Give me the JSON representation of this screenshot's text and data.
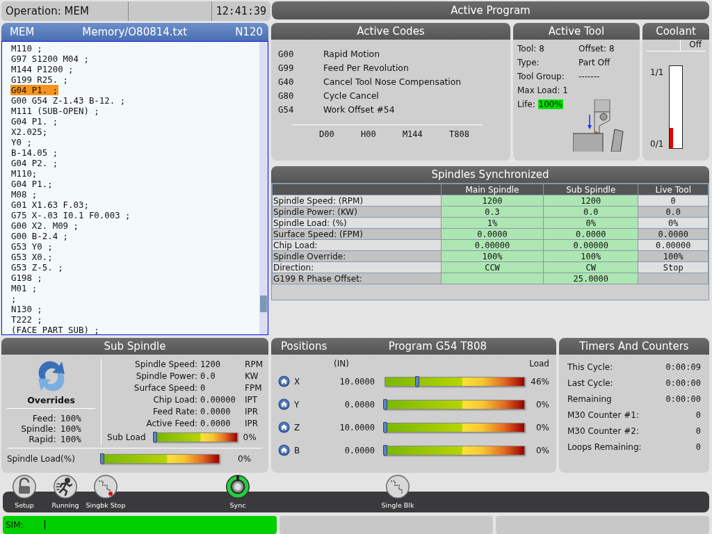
{
  "status": {
    "operation": "Operation: MEM",
    "time": "12:41:39"
  },
  "active_program_title": "Active Program",
  "program": {
    "mode": "MEM",
    "path": "Memory/O80814.txt",
    "block": "N120",
    "lines": [
      {
        "text": "M110 ;",
        "selected": false
      },
      {
        "text": "G97 S1200 M04 ;",
        "selected": false
      },
      {
        "text": "M144 P1200 ;",
        "selected": false
      },
      {
        "text": "G199 R25. ;",
        "selected": false
      },
      {
        "text": "G04 P1. ;",
        "selected": true
      },
      {
        "text": "G00 G54 Z-1.43 B-12. ;",
        "selected": false
      },
      {
        "text": "M111 (SUB-OPEN) ;",
        "selected": false
      },
      {
        "text": "G04 P1. ;",
        "selected": false
      },
      {
        "text": "X2.025;",
        "selected": false
      },
      {
        "text": "Y0 ;",
        "selected": false
      },
      {
        "text": "B-14.05 ;",
        "selected": false
      },
      {
        "text": "G04 P2. ;",
        "selected": false
      },
      {
        "text": "M110;",
        "selected": false
      },
      {
        "text": "G04 P1.;",
        "selected": false
      },
      {
        "text": "M08 ;",
        "selected": false
      },
      {
        "text": "G01 X1.63 F.03;",
        "selected": false
      },
      {
        "text": "G75 X-.03 I0.1 F0.003 ;",
        "selected": false
      },
      {
        "text": "G00 X2. M09 ;",
        "selected": false
      },
      {
        "text": "G00 B-2.4 ;",
        "selected": false
      },
      {
        "text": "G53 Y0 ;",
        "selected": false
      },
      {
        "text": "G53 X0.;",
        "selected": false
      },
      {
        "text": "G53 Z-5. ;",
        "selected": false
      },
      {
        "text": "G198 ;",
        "selected": false
      },
      {
        "text": "M01 ;",
        "selected": false
      },
      {
        "text": ";",
        "selected": false
      },
      {
        "text": "N130 ;",
        "selected": false
      },
      {
        "text": "T222 ;",
        "selected": false
      },
      {
        "text": "(FACE PART SUB) ;",
        "selected": false
      }
    ]
  },
  "active_codes": {
    "title": "Active Codes",
    "codes": [
      {
        "code": "G00",
        "description": "Rapid Motion"
      },
      {
        "code": "G99",
        "description": "Feed Per Revolution"
      },
      {
        "code": "G40",
        "description": "Cancel Tool Nose Compensation"
      },
      {
        "code": "G80",
        "description": "Cycle Cancel"
      },
      {
        "code": "G54",
        "description": "Work Offset #54"
      }
    ],
    "footer": [
      "D00",
      "H00",
      "M144",
      "T808"
    ]
  },
  "active_tool": {
    "title": "Active Tool",
    "tool": "Tool: 8",
    "offset": "Offset: 8",
    "type_label": "Type:",
    "type": "Part Off",
    "group_label": "Tool Group:",
    "group": "-------",
    "max_load": "Max Load: 1",
    "life_label": "Life:",
    "life": "100%"
  },
  "coolant": {
    "title": "Coolant",
    "state": "Off",
    "top_label": "1/1",
    "bottom_label": "0/1",
    "level": 0.25
  },
  "spindles": {
    "title": "Spindles Synchronized",
    "columns": [
      {
        "label": "Main Spindle",
        "active": true
      },
      {
        "label": "Sub Spindle",
        "active": true
      },
      {
        "label": "Live Tool",
        "active": false
      }
    ],
    "rows": [
      {
        "label": "Spindle Speed: (RPM)",
        "cells": [
          {
            "text": "1200"
          },
          {
            "text": "1200"
          },
          {
            "text": "0"
          }
        ]
      },
      {
        "label": "Spindle Power: (KW)",
        "cells": [
          {
            "text": "0.3"
          },
          {
            "text": "0.0"
          },
          {
            "text": "0.0"
          }
        ]
      },
      {
        "label": "Spindle Load: (%)",
        "cells": [
          {
            "text": "1%"
          },
          {
            "text": "0%"
          },
          {
            "text": "0%"
          }
        ]
      },
      {
        "label": "Surface Speed: (FPM)",
        "cells": [
          {
            "text": "0.0000"
          },
          {
            "text": "0.0000"
          },
          {
            "text": "0.0000"
          }
        ]
      },
      {
        "label": "Chip Load:",
        "cells": [
          {
            "text": "0.00000"
          },
          {
            "text": "0.00000"
          },
          {
            "text": "0.00000"
          }
        ]
      },
      {
        "label": "Spindle Override:",
        "cells": [
          {
            "text": "100%"
          },
          {
            "text": "100%"
          },
          {
            "text": "100%"
          }
        ]
      },
      {
        "label": "Direction:",
        "cells": [
          {
            "text": "CCW"
          },
          {
            "text": "CW"
          },
          {
            "text": "Stop"
          }
        ]
      },
      {
        "label": "G199 R Phase Offset:",
        "cells": [
          {},
          {
            "text": "25.0000"
          },
          {}
        ]
      }
    ]
  },
  "sub_spindle": {
    "title": "Sub Spindle",
    "overrides_title": "Overrides",
    "overrides": [
      {
        "label": "Feed:",
        "value": "100%"
      },
      {
        "label": "Spindle:",
        "value": "100%"
      },
      {
        "label": "Rapid:",
        "value": "100%"
      }
    ],
    "readings": [
      {
        "label": "Spindle Speed:",
        "value": "1200",
        "unit": "RPM"
      },
      {
        "label": "Spindle Power:",
        "value": "0.0",
        "unit": "KW"
      },
      {
        "label": "Surface Speed:",
        "value": "0",
        "unit": "FPM"
      },
      {
        "label": "Chip Load:",
        "value": "0.00000",
        "unit": "IPT"
      },
      {
        "label": "Feed Rate:",
        "value": "0.0000",
        "unit": "IPR"
      },
      {
        "label": "Active Feed:",
        "value": "0.0000",
        "unit": "IPR"
      }
    ],
    "sub_load": {
      "label": "Sub Load",
      "level": 0,
      "reading": "0%"
    },
    "spindle_load": {
      "label": "Spindle Load(%)",
      "level": 0,
      "reading": "0%"
    }
  },
  "positions": {
    "title": "Positions",
    "program": "Program G54 T808",
    "units": "(IN)",
    "load_header": "Load",
    "axes": [
      {
        "axis": "X",
        "value": "10.0000",
        "level": 0.23,
        "reading": "46%"
      },
      {
        "axis": "Y",
        "value": "0.0000",
        "level": 0,
        "reading": "0%"
      },
      {
        "axis": "Z",
        "value": "10.0000",
        "level": 0,
        "reading": "0%"
      },
      {
        "axis": "B",
        "value": "0.0000",
        "level": 0,
        "reading": "0%"
      }
    ]
  },
  "timers": {
    "title": "Timers And Counters",
    "rows": [
      {
        "label": "This Cycle:",
        "value": "0:00:09"
      },
      {
        "label": "Last Cycle:",
        "value": "0:00:00"
      },
      {
        "label": "Remaining",
        "value": "0:00:00"
      },
      {
        "label": "M30 Counter #1:",
        "value": "0"
      },
      {
        "label": "M30 Counter #2:",
        "value": "0"
      },
      {
        "label": "Loops Remaining:",
        "value": "0"
      }
    ]
  },
  "toolbar": [
    {
      "kind": "lock",
      "label": "Setup"
    },
    {
      "kind": "runner",
      "label": "Running"
    },
    {
      "kind": "steps-stop",
      "label": "Singbk Stop"
    },
    {
      "kind": "sync",
      "label": "Sync"
    },
    {
      "kind": "steps",
      "label": "Single Blk"
    }
  ],
  "status_bar": {
    "sim": "SIM:"
  }
}
